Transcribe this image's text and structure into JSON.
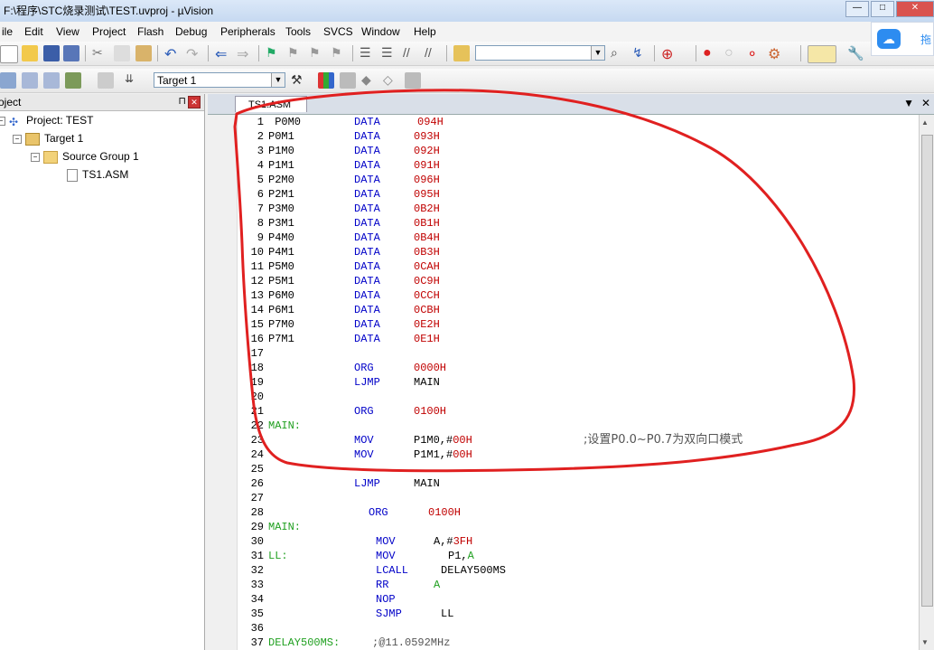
{
  "window": {
    "title": "F:\\程序\\STC烧录测试\\TEST.uvproj - µVision"
  },
  "menu": [
    "ile",
    "Edit",
    "View",
    "Project",
    "Flash",
    "Debug",
    "Peripherals",
    "Tools",
    "SVCS",
    "Window",
    "Help"
  ],
  "toolbar": {
    "search_combo_value": "",
    "target_combo_value": "Target 1"
  },
  "cloud_widget": {
    "label": "拖"
  },
  "project_panel": {
    "title": "oject",
    "tree": [
      {
        "label": "Project: TEST",
        "icon": "project-icon"
      },
      {
        "label": "Target 1",
        "icon": "target-folder-icon"
      },
      {
        "label": "Source Group 1",
        "icon": "folder-icon"
      },
      {
        "label": "TS1.ASM",
        "icon": "file-icon"
      }
    ]
  },
  "editor": {
    "tab_label": "TS1.ASM",
    "lines": [
      {
        "n": "1",
        "label": " P0M0",
        "mn": "DATA",
        "op": "094H"
      },
      {
        "n": "2",
        "label": "P0M1",
        "mn": "DATA",
        "op": "093H"
      },
      {
        "n": "3",
        "label": "P1M0",
        "mn": "DATA",
        "op": "092H"
      },
      {
        "n": "4",
        "label": "P1M1",
        "mn": "DATA",
        "op": "091H"
      },
      {
        "n": "5",
        "label": "P2M0",
        "mn": "DATA",
        "op": "096H"
      },
      {
        "n": "6",
        "label": "P2M1",
        "mn": "DATA",
        "op": "095H"
      },
      {
        "n": "7",
        "label": "P3M0",
        "mn": "DATA",
        "op": "0B2H"
      },
      {
        "n": "8",
        "label": "P3M1",
        "mn": "DATA",
        "op": "0B1H"
      },
      {
        "n": "9",
        "label": "P4M0",
        "mn": "DATA",
        "op": "0B4H"
      },
      {
        "n": "10",
        "label": "P4M1",
        "mn": "DATA",
        "op": "0B3H"
      },
      {
        "n": "11",
        "label": "P5M0",
        "mn": "DATA",
        "op": "0CAH"
      },
      {
        "n": "12",
        "label": "P5M1",
        "mn": "DATA",
        "op": "0C9H"
      },
      {
        "n": "13",
        "label": "P6M0",
        "mn": "DATA",
        "op": "0CCH"
      },
      {
        "n": "14",
        "label": "P6M1",
        "mn": "DATA",
        "op": "0CBH"
      },
      {
        "n": "15",
        "label": "P7M0",
        "mn": "DATA",
        "op": "0E2H"
      },
      {
        "n": "16",
        "label": "P7M1",
        "mn": "DATA",
        "op": "0E1H"
      },
      {
        "n": "17",
        "label": "",
        "mn": "",
        "op": ""
      },
      {
        "n": "18",
        "label": "",
        "mn": "ORG",
        "op": "0000H"
      },
      {
        "n": "19",
        "label": "",
        "mn": "LJMP",
        "op": "MAIN"
      },
      {
        "n": "20",
        "label": "",
        "mn": "",
        "op": ""
      },
      {
        "n": "21",
        "label": "",
        "mn": "ORG",
        "op": "0100H"
      },
      {
        "n": "22",
        "label": "MAIN:",
        "mn": "",
        "op": ""
      },
      {
        "n": "23",
        "label": "",
        "mn": "MOV",
        "op": "P1M0,#00H",
        "comment": ";设置P0.0~P0.7为双向口模式"
      },
      {
        "n": "24",
        "label": "",
        "mn": "MOV",
        "op": "P1M1,#00H"
      },
      {
        "n": "25",
        "label": "",
        "mn": "",
        "op": ""
      },
      {
        "n": "26",
        "label": "",
        "mn": "LJMP",
        "op": "MAIN"
      },
      {
        "n": "27",
        "label": "",
        "mn": "",
        "op": ""
      },
      {
        "n": "28",
        "label": "",
        "mn": "ORG",
        "op": "0100H"
      },
      {
        "n": "29",
        "label": "MAIN:",
        "mn": "",
        "op": ""
      },
      {
        "n": "30",
        "label": "",
        "mn": "MOV",
        "op": "A,#3FH"
      },
      {
        "n": "31",
        "label": "LL:",
        "mn": "MOV",
        "op": "P1,A"
      },
      {
        "n": "32",
        "label": "",
        "mn": "LCALL",
        "op": "DELAY500MS"
      },
      {
        "n": "33",
        "label": "",
        "mn": "RR",
        "op": "A"
      },
      {
        "n": "34",
        "label": "",
        "mn": "NOP",
        "op": ""
      },
      {
        "n": "35",
        "label": "",
        "mn": "SJMP",
        "op": "LL"
      },
      {
        "n": "36",
        "label": "",
        "mn": "",
        "op": ""
      },
      {
        "n": "37",
        "label": "DELAY500MS:",
        "mn": "",
        "op": ";@11.0592MHz"
      }
    ]
  },
  "colors": {
    "mnemonic": "#0000c8",
    "hex": "#c00000",
    "label": "#20a020",
    "annotation": "#e02020"
  }
}
